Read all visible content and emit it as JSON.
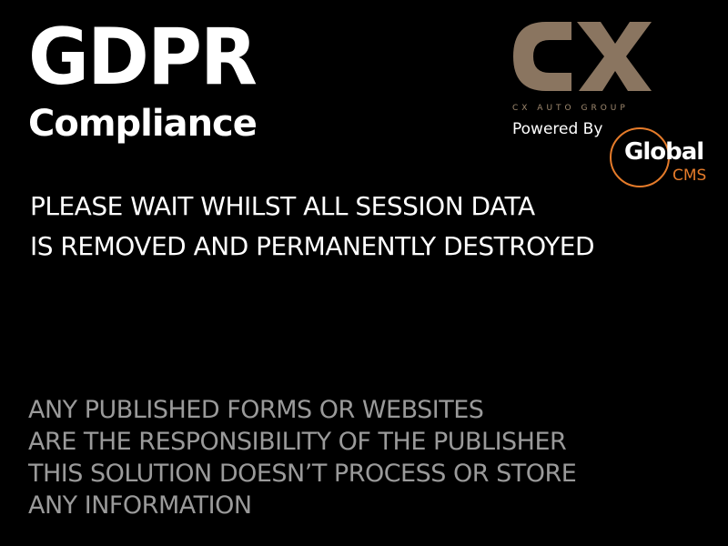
{
  "header": {
    "title": "GDPR",
    "subtitle": "Compliance"
  },
  "brand": {
    "logo_letters": "CX",
    "logo_subtitle": "CX AUTO GROUP",
    "logo_color": "#8a7560",
    "powered_by": "Powered By",
    "partner_name": "Global",
    "partner_suffix": "CMS",
    "partner_accent": "#e57b2a"
  },
  "message": {
    "lines": [
      "PLEASE WAIT WHILST ALL SESSION DATA",
      "IS REMOVED AND PERMANENTLY DESTROYED"
    ]
  },
  "disclaimer": {
    "lines": [
      "ANY PUBLISHED FORMS OR WEBSITES",
      "ARE THE RESPONSIBILITY OF THE PUBLISHER",
      "THIS SOLUTION DOESN’T PROCESS OR STORE",
      "ANY INFORMATION"
    ]
  }
}
